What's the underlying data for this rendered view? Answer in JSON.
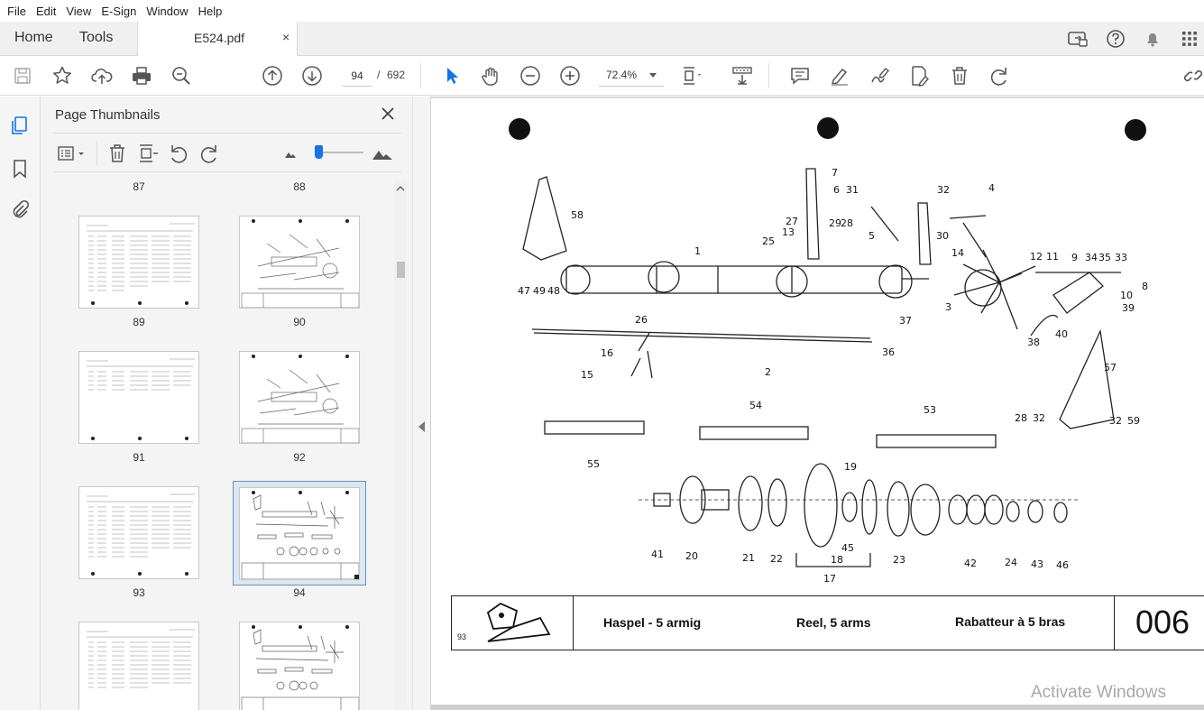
{
  "menubar": {
    "items": [
      "File",
      "Edit",
      "View",
      "E-Sign",
      "Window",
      "Help"
    ]
  },
  "tabs": {
    "home": "Home",
    "tools": "Tools",
    "document": "E524.pdf",
    "close_glyph": "×"
  },
  "toolbar": {
    "current_page": "94",
    "separator": "/",
    "total_pages": "692",
    "zoom": "72.4%"
  },
  "panel": {
    "title": "Page Thumbnails",
    "zoom_slider_level": 0.2
  },
  "thumbnails": {
    "labels": [
      "87",
      "88",
      "89",
      "90",
      "91",
      "92",
      "93",
      "94"
    ],
    "selected_page": "94"
  },
  "document": {
    "part_numbers": [
      "58",
      "1",
      "7",
      "6",
      "31",
      "27",
      "13",
      "29",
      "28",
      "25",
      "5",
      "4",
      "32",
      "30",
      "14",
      "12",
      "11",
      "9",
      "34",
      "35",
      "33",
      "8",
      "10",
      "39",
      "3",
      "40",
      "38",
      "47",
      "49",
      "48",
      "26",
      "37",
      "36",
      "16",
      "15",
      "2",
      "57",
      "28",
      "32",
      "32",
      "59",
      "54",
      "53",
      "55",
      "19",
      "41",
      "20",
      "21",
      "22",
      "18",
      "45",
      "17",
      "23",
      "42",
      "24",
      "43",
      "46"
    ],
    "title_block": {
      "page_ref": "93",
      "name_de": "Haspel - 5 armig",
      "name_en": "Reel, 5 arms",
      "name_fr": "Rabatteur à 5 bras",
      "code": "006"
    }
  },
  "watermark": "Activate Windows",
  "colors": {
    "accent": "#1473e6",
    "tab_bar": "#f0f0f0",
    "panel_bg": "#f4f4f4",
    "selection": "#dbe6f3"
  }
}
